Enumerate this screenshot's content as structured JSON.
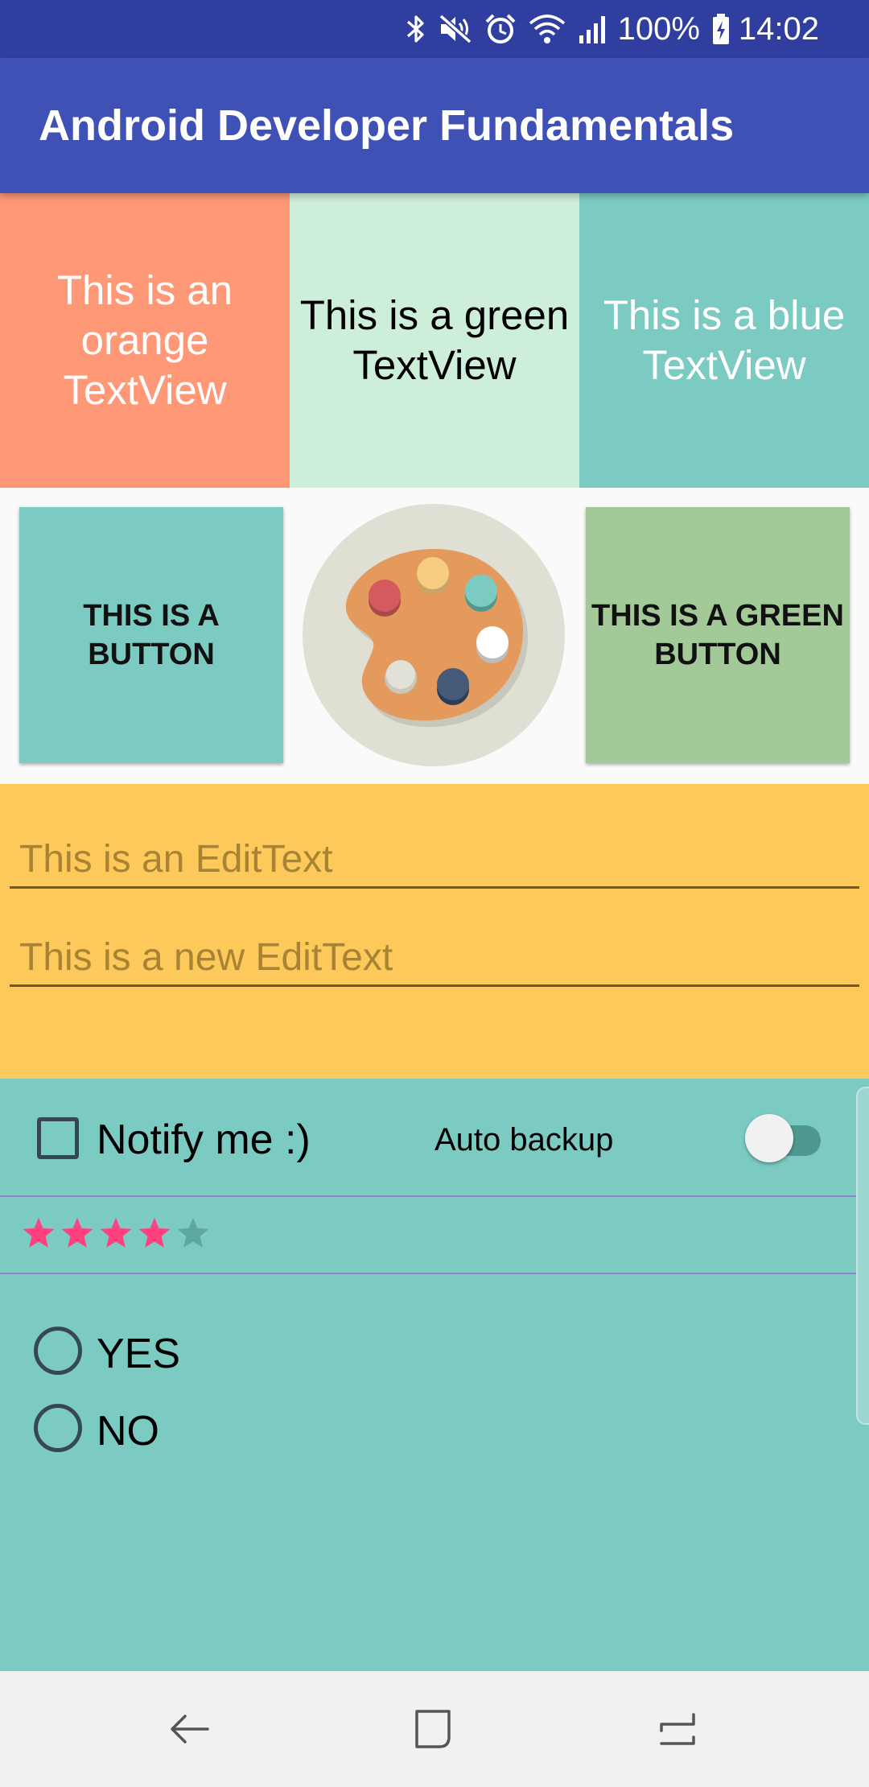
{
  "status_bar": {
    "battery": "100%",
    "time": "14:02",
    "icons": [
      "bluetooth-icon",
      "mute-icon",
      "alarm-icon",
      "wifi-icon",
      "signal-icon",
      "battery-icon"
    ]
  },
  "app_bar": {
    "title": "Android Developer Fundamentals"
  },
  "textviews": {
    "orange": "This is an orange TextView",
    "green": "This is a green TextView",
    "blue": "This is a blue TextView"
  },
  "buttons": {
    "teal": "THIS IS A BUTTON",
    "green": "THIS IS A GREEN BUTTON"
  },
  "image": {
    "icon": "palette-icon"
  },
  "edit_texts": {
    "first_placeholder": "This is an EditText",
    "second_placeholder": "This is a new EditText"
  },
  "notify": {
    "checkbox_label": "Notify me :)",
    "checked": false
  },
  "auto_backup": {
    "label": "Auto backup",
    "on": false
  },
  "rating": {
    "value": 4,
    "max": 5
  },
  "radio": {
    "options": [
      "YES",
      "NO"
    ],
    "selected": null
  },
  "nav_bar": {
    "icons": [
      "back-icon",
      "home-icon",
      "recents-icon"
    ]
  },
  "colors": {
    "status_bar": "#303f9f",
    "app_bar": "#3f51b5",
    "orange": "#ff9877",
    "light_green": "#cdeed9",
    "teal": "#7bcbc3",
    "green_button": "#a2c997",
    "yellow": "#fdc95a",
    "star_active": "#ff4081"
  }
}
